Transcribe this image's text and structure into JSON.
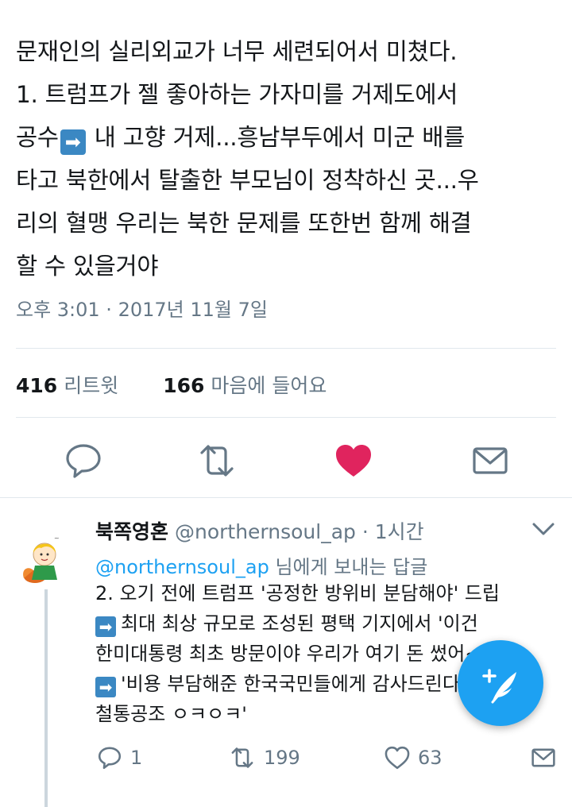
{
  "tweet": {
    "lines": [
      "문재인의 실리외교가 너무 세련되어서 미쳤다.",
      "1. 트럼프가 젤 좋아하는 가자미를 거제도에서",
      "공수",
      "내 고향 거제...흥남부두에서 미군 배를",
      "타고 북한에서 탈출한 부모님이 정착하신 곳...우",
      "리의 혈맹 우리는 북한 문제를 또한번 함께 해결",
      "할 수 있을거야"
    ],
    "timestamp": "오후 3:01 · 2017년 11월 7일",
    "retweet_count": "416",
    "retweet_label": "리트윗",
    "like_count": "166",
    "like_label": "마음에 들어요"
  },
  "reply": {
    "name": "북쪽영혼",
    "handle": "@northernsoul_ap",
    "time": " · 1시간",
    "reply_to_mention": "@northernsoul_ap",
    "reply_to_suffix": " 님에게 보내는 답글",
    "lines": [
      "2. 오기 전에 트럼프 '공정한 방위비 분담해야' 드립",
      "최대 최상 규모로 조성된 평택 기지에서 '이건",
      "한미대통령 최초 방문이야 우리가 여기 돈 썼어~'",
      "'비용 부담해준 한국국민들에게 감사드린다 한미",
      "철통공조 ㅇㅋㅇㅋ'"
    ],
    "reply_count": "1",
    "retweet_count": "199",
    "like_count": "63"
  },
  "icons": {
    "arrow_emoji": "right-arrow-emoji",
    "arrow_glyph": "➡"
  },
  "colors": {
    "accent": "#1da1f2",
    "like": "#e0245e",
    "muted": "#657786",
    "emoji_blue": "#3b88c3"
  }
}
